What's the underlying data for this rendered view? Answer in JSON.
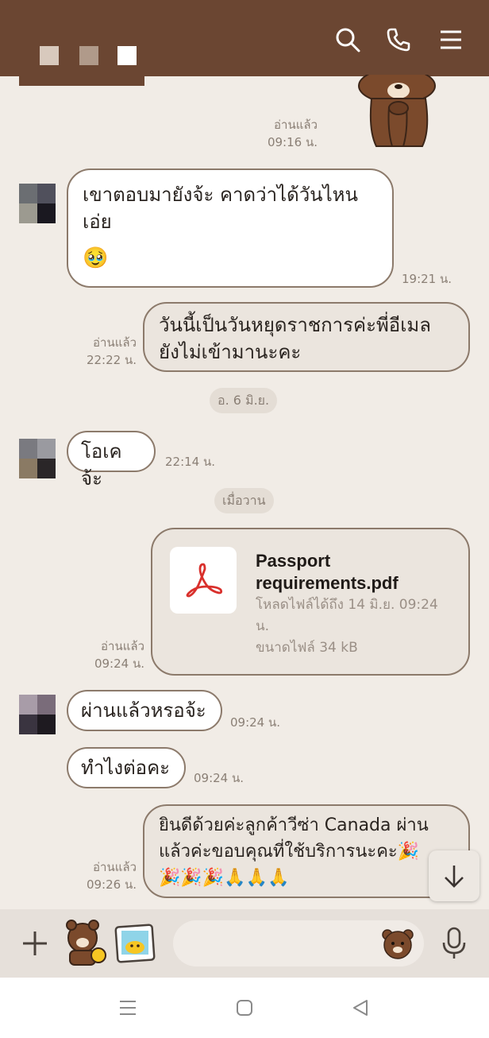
{
  "header": {
    "icons": [
      "search-icon",
      "phone-icon",
      "menu-icon"
    ],
    "colors": {
      "bar": "#6b4632"
    }
  },
  "messages": {
    "m1": {
      "read": "อ่านแล้ว",
      "time": "09:16 น."
    },
    "m2": {
      "text_line1": "เขาตอบมายังจ้ะ คาดว่าได้วันไหน",
      "text_line2": "เอ่ย",
      "emoji": "🥹",
      "time": "19:21 น."
    },
    "m3": {
      "text_line1": "วันนี้เป็นวันหยุดราชการค่ะพี่อีเมล",
      "text_line2": "ยังไม่เข้ามานะคะ",
      "read": "อ่านแล้ว",
      "time": "22:22 น."
    },
    "date1": "อ. 6 มิ.ย.",
    "m4": {
      "text": "โอเคจ้ะ",
      "time": "22:14 น."
    },
    "date2": "เมื่อวาน",
    "m5": {
      "file_name_line1": "Passport",
      "file_name_line2": "requirements.pdf",
      "download_until": "โหลดไฟล์ได้ถึง 14 มิ.ย. 09:24",
      "download_until_tail": "น.",
      "file_size": "ขนาดไฟล์ 34 kB",
      "read": "อ่านแล้ว",
      "time": "09:24 น."
    },
    "m6": {
      "text": "ผ่านแล้วหรอจ้ะ",
      "time": "09:24 น."
    },
    "m7": {
      "text": "ทำไงต่อคะ",
      "time": "09:24 น."
    },
    "m8": {
      "text_line1": "ยินดีด้วยค่ะลูกค้าวีซ่า Canada ผ่าน",
      "text_line2": "แล้วค่ะขอบคุณที่ใช้บริการนะคะ🎉",
      "text_line3": "🎉🎉🎉🙏🙏🙏",
      "read": "อ่านแล้ว",
      "time": "09:26 น."
    }
  },
  "input": {
    "placeholder": ""
  },
  "icons": {
    "scroll": "arrow-down-icon",
    "input_bar": [
      "plus-icon",
      "sticker-icon",
      "gallery-icon",
      "emoji-bear-icon",
      "microphone-icon"
    ],
    "system_nav": [
      "recent-apps-icon",
      "home-icon",
      "back-icon"
    ]
  }
}
